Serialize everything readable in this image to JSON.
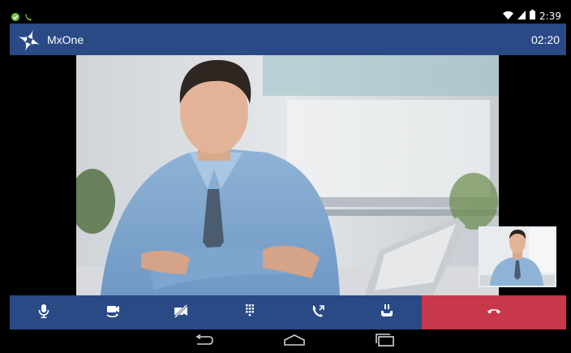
{
  "app": {
    "title": "MxOne",
    "call_timer": "02:20"
  },
  "statusbar": {
    "time": "2:39",
    "icons": [
      "check-circle-icon",
      "phone-call-icon",
      "wifi-icon",
      "signal-icon",
      "battery-icon"
    ]
  },
  "call_controls": [
    {
      "name": "mute-button",
      "icon": "microphone-icon"
    },
    {
      "name": "switch-camera-button",
      "icon": "camera-switch-icon"
    },
    {
      "name": "video-off-button",
      "icon": "video-off-icon"
    },
    {
      "name": "dialpad-button",
      "icon": "dialpad-icon"
    },
    {
      "name": "transfer-button",
      "icon": "call-transfer-icon"
    },
    {
      "name": "hold-button",
      "icon": "hold-icon"
    },
    {
      "name": "end-call-button",
      "icon": "hangup-icon"
    }
  ],
  "navigation": [
    "back-icon",
    "home-icon",
    "recent-apps-icon"
  ],
  "colors": {
    "primary": "#2a4a86",
    "end_call": "#c8374a",
    "background": "#000000"
  }
}
